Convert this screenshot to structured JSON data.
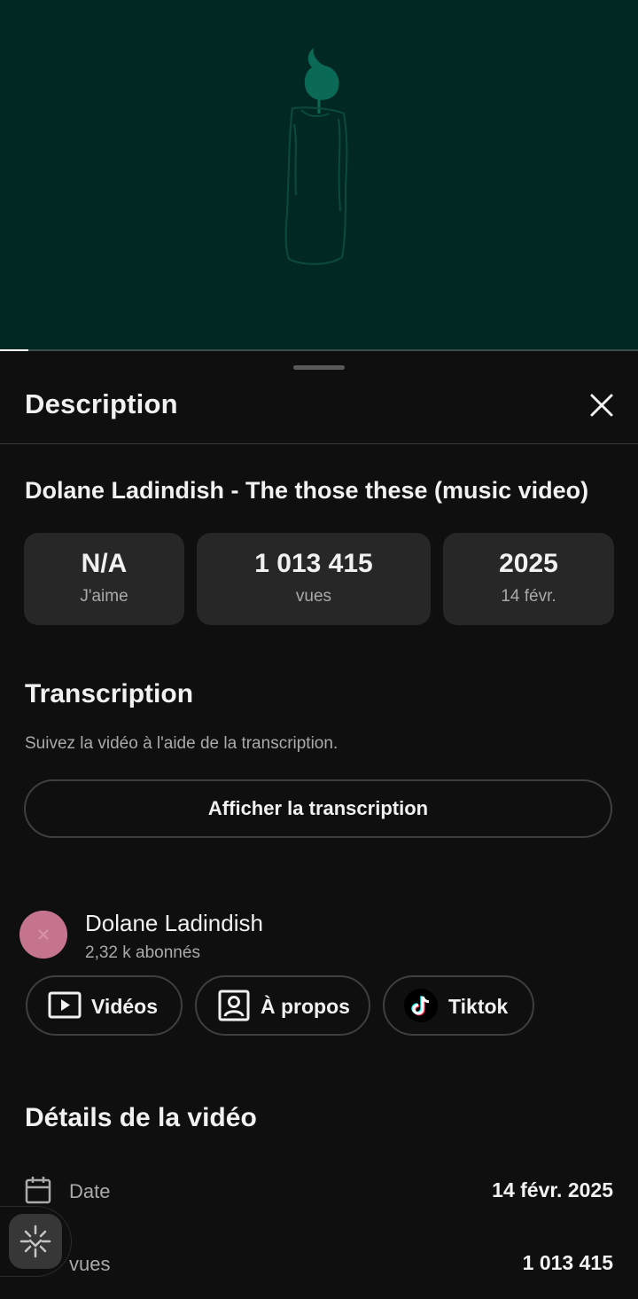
{
  "sheet": {
    "title": "Description",
    "video_title": "Dolane Ladindish - The those these  (music video)"
  },
  "stats": [
    {
      "value": "N/A",
      "label": "J'aime"
    },
    {
      "value": "1 013 415",
      "label": "vues"
    },
    {
      "value": "2025",
      "label": "14 févr."
    }
  ],
  "transcript": {
    "title": "Transcription",
    "helper": "Suivez la vidéo à l'aide de la transcription.",
    "button": "Afficher la transcription"
  },
  "channel": {
    "name": "Dolane Ladindish",
    "subscribers": "2,32 k abonnés",
    "chips": [
      {
        "label": "Vidéos",
        "icon": "play-box-icon"
      },
      {
        "label": "À propos",
        "icon": "profile-box-icon"
      },
      {
        "label": "Tiktok",
        "icon": "tiktok-icon"
      }
    ]
  },
  "details": {
    "title": "Détails de la vidéo",
    "rows": [
      {
        "label": "Date",
        "value": "14 févr. 2025",
        "icon": "calendar-icon"
      },
      {
        "label": "vues",
        "value": "1 013 415",
        "icon": "play-box-icon"
      }
    ]
  },
  "player": {
    "progress": 0.045,
    "background_color": "#022823",
    "accent_color": "#0a6a55"
  }
}
